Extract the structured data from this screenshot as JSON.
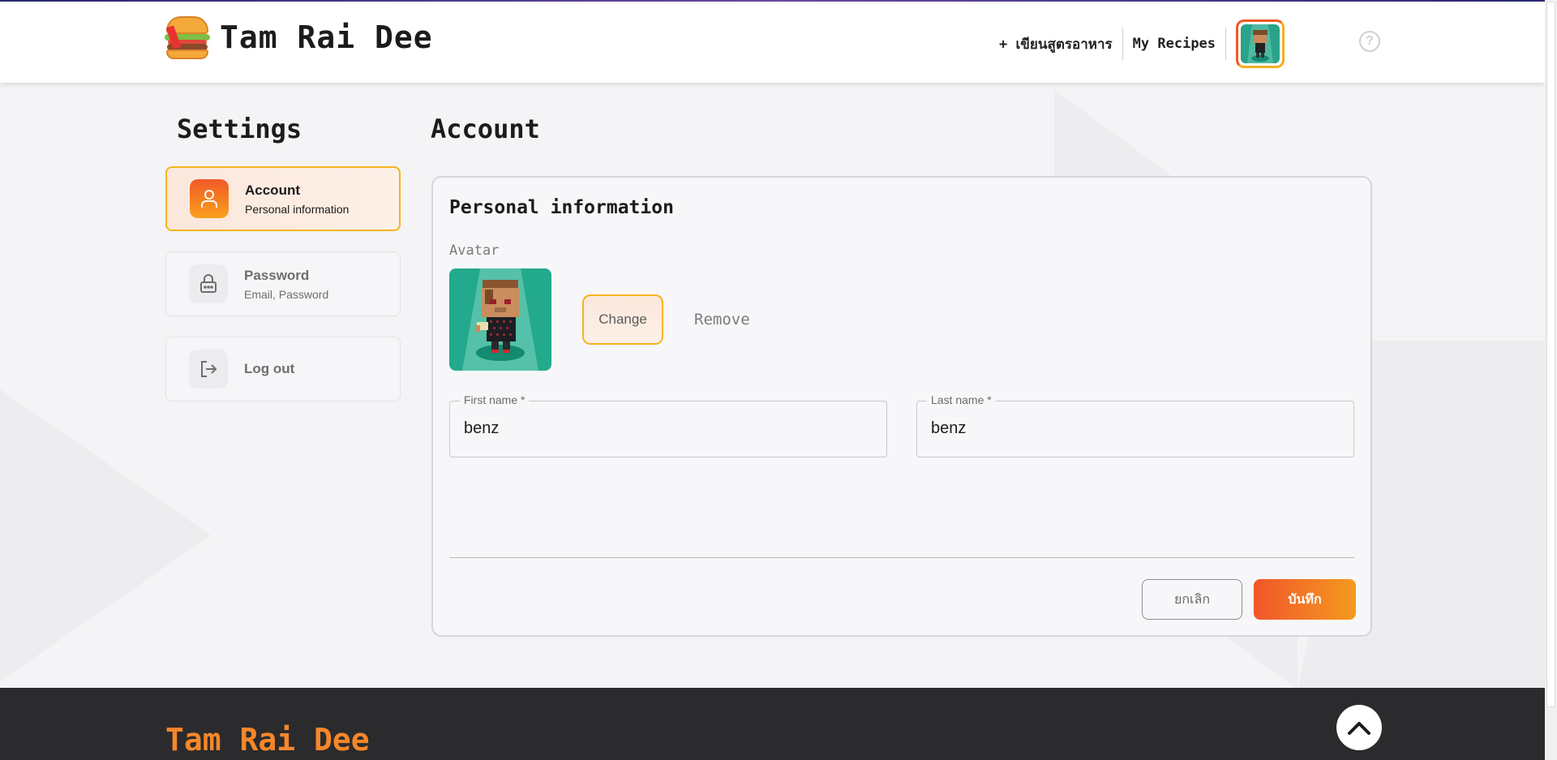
{
  "header": {
    "app_name": "Tam Rai Dee",
    "nav_write_recipe": "+ เขียนสูตรอาหาร",
    "nav_my_recipes": "My Recipes",
    "help_glyph": "?"
  },
  "sidebar": {
    "title": "Settings",
    "items": [
      {
        "label": "Account",
        "sub": "Personal information",
        "icon": "user-icon",
        "active": true
      },
      {
        "label": "Password",
        "sub": "Email, Password",
        "icon": "lock-icon",
        "active": false
      },
      {
        "label": "Log out",
        "sub": "",
        "icon": "logout-icon",
        "active": false
      }
    ]
  },
  "main": {
    "title": "Account",
    "panel_title": "Personal information",
    "avatar_label": "Avatar",
    "change_label": "Change",
    "remove_label": "Remove",
    "first_name": {
      "label": "First name *",
      "value": "benz"
    },
    "last_name": {
      "label": "Last name *",
      "value": "benz"
    },
    "cancel_label": "ยกเลิก",
    "save_label": "บันทึก"
  },
  "footer": {
    "brand": "Tam Rai Dee"
  },
  "colors": {
    "accent_orange": "#f1562a",
    "accent_yellow": "#f5b41e",
    "footer_bg": "#2b2b2d",
    "brand_orange": "#f5872a"
  }
}
